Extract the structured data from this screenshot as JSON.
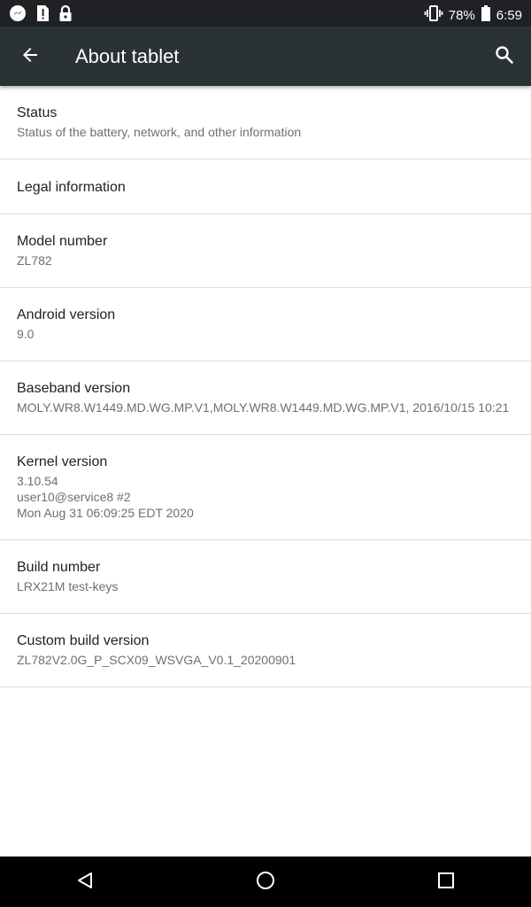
{
  "status_bar": {
    "left_icons": [
      "messenger-icon",
      "sim-alert-icon",
      "lock-icon"
    ],
    "right_icons": [
      "vibrate-icon",
      "battery-icon"
    ],
    "battery_percent": "78%",
    "time": "6:59"
  },
  "app_bar": {
    "title": "About tablet",
    "back_icon": "arrow-back-icon",
    "search_icon": "search-icon"
  },
  "items": [
    {
      "title": "Status",
      "summary": [
        "Status of the battery, network, and other information"
      ]
    },
    {
      "title": "Legal information",
      "summary": []
    },
    {
      "title": "Model number",
      "summary": [
        "ZL782"
      ]
    },
    {
      "title": "Android version",
      "summary": [
        "9.0"
      ]
    },
    {
      "title": "Baseband version",
      "summary": [
        "MOLY.WR8.W1449.MD.WG.MP.V1,MOLY.WR8.W1449.MD.WG.MP.V1, 2016/10/15 10:21"
      ]
    },
    {
      "title": "Kernel version",
      "summary": [
        "3.10.54",
        "user10@service8 #2",
        "Mon Aug 31 06:09:25 EDT 2020"
      ]
    },
    {
      "title": "Build number",
      "summary": [
        "LRX21M test-keys"
      ]
    },
    {
      "title": "Custom build version",
      "summary": [
        "ZL782V2.0G_P_SCX09_WSVGA_V0.1_20200901"
      ]
    }
  ],
  "nav_bar": {
    "buttons": [
      "back-triangle-icon",
      "home-circle-icon",
      "recents-square-icon"
    ]
  },
  "colors": {
    "status_bar": "#1f2124",
    "app_bar": "#2b3236",
    "title_text": "#212121",
    "summary_text": "#6f6f6f",
    "divider": "#dcdcdc",
    "nav_bar": "#000000"
  }
}
